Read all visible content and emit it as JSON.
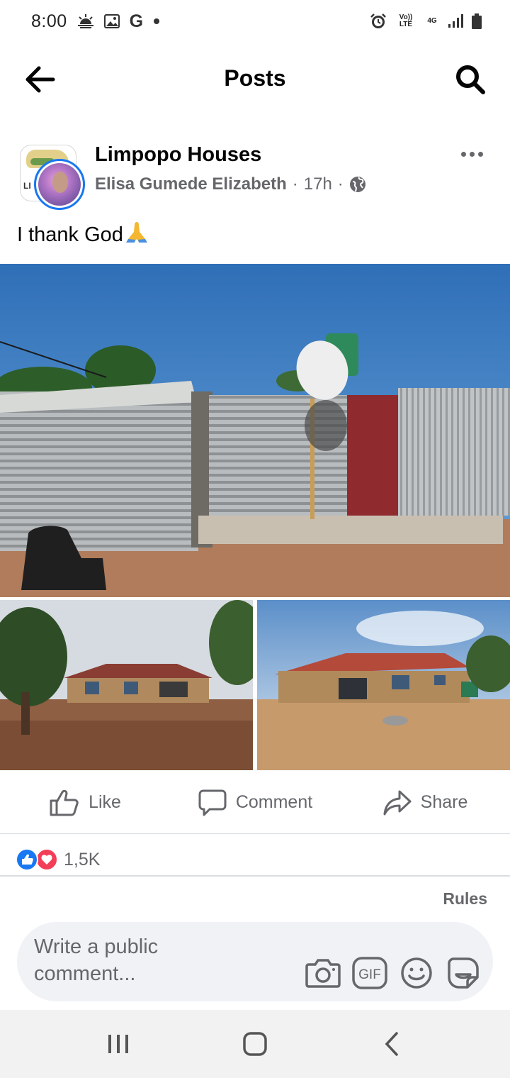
{
  "status_bar": {
    "time": "8:00",
    "left_icons": [
      "sunrise-weather-icon",
      "gallery-icon",
      "google-icon",
      "dot-icon"
    ],
    "google_letter": "G",
    "network_volte": "Vo)) LTE",
    "network_4g": "4G",
    "right_icons": [
      "alarm-icon",
      "volte-icon",
      "4g-icon",
      "signal-icon",
      "battery-icon"
    ]
  },
  "header": {
    "title": "Posts",
    "back_icon": "arrow-left-icon",
    "search_icon": "search-icon"
  },
  "post": {
    "group_name": "Limpopo Houses",
    "group_avatar_text": "LI",
    "author": "Elisa Gumede Elizabeth",
    "time": "17h",
    "separator": "·",
    "privacy_icon": "globe-icon",
    "text": "I thank God",
    "emoji": "folded-hands-emoji",
    "photos": [
      "shack-corrugated-iron",
      "house-under-construction-1",
      "house-under-construction-2"
    ]
  },
  "actions": {
    "like_label": "Like",
    "comment_label": "Comment",
    "share_label": "Share"
  },
  "reactions": {
    "count": "1,5K",
    "types": [
      "like",
      "love"
    ]
  },
  "comments": {
    "rules_label": "Rules",
    "placeholder": "Write a public comment...",
    "tools": [
      "camera-icon",
      "gif-icon",
      "emoji-icon",
      "sticker-icon"
    ],
    "gif_label": "GIF"
  },
  "nav": {
    "buttons": [
      "recent-apps",
      "home",
      "back"
    ]
  },
  "colors": {
    "brand_blue": "#1877f2",
    "love_red": "#f33e58",
    "secondary_text": "#65676b",
    "comment_bg": "#f0f2f5",
    "nav_bg": "#f2f2f2"
  }
}
